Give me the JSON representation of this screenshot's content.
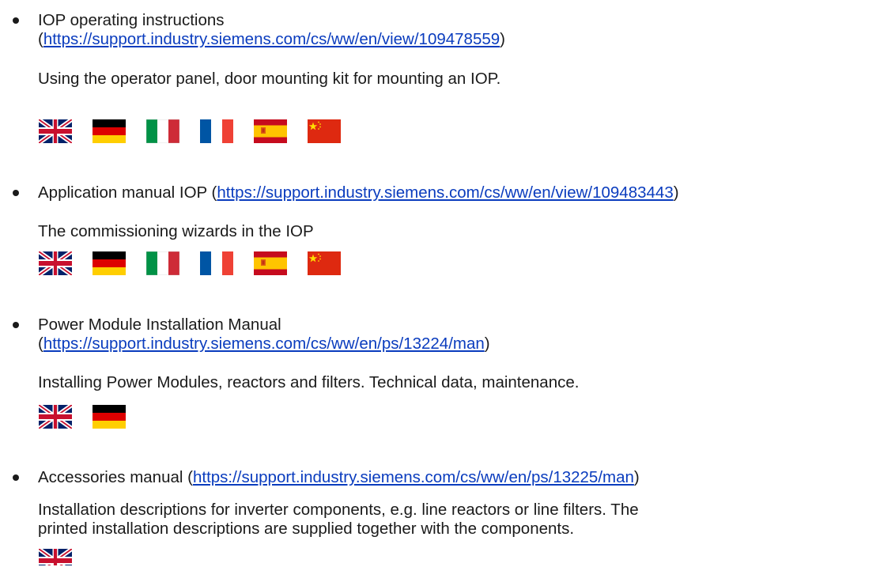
{
  "entries": [
    {
      "title": "IOP operating instructions",
      "open_paren": "(",
      "url": "https://support.industry.siemens.com/cs/ww/en/view/109478559",
      "close_paren": ")",
      "description": [
        "Using the operator panel, door mounting kit for mounting an IOP."
      ],
      "flags": [
        "uk-flag-icon",
        "germany-flag-icon",
        "italy-flag-icon",
        "france-flag-icon",
        "spain-flag-icon",
        "china-flag-icon"
      ]
    },
    {
      "title": "Application manual IOP (",
      "url": "https://support.industry.siemens.com/cs/ww/en/view/109483443",
      "close_paren": ")",
      "description": [
        "The commissioning wizards in the IOP"
      ],
      "flags": [
        "uk-flag-icon",
        "germany-flag-icon",
        "italy-flag-icon",
        "france-flag-icon",
        "spain-flag-icon",
        "china-flag-icon"
      ]
    },
    {
      "title": "Power Module Installation Manual",
      "open_paren": "(",
      "url": "https://support.industry.siemens.com/cs/ww/en/ps/13224/man",
      "close_paren": ")",
      "description": [
        "Installing Power Modules, reactors and filters. Technical data, maintenance."
      ],
      "flags": [
        "uk-flag-icon",
        "germany-flag-icon"
      ]
    },
    {
      "title": "Accessories manual (",
      "url": "https://support.industry.siemens.com/cs/ww/en/ps/13225/man",
      "close_paren": ")",
      "description": [
        "Installation descriptions for inverter components, e.g. line reactors or line filters. The",
        "printed installation descriptions are supplied together with the components."
      ],
      "flags": [
        "uk-flag-icon"
      ]
    }
  ]
}
